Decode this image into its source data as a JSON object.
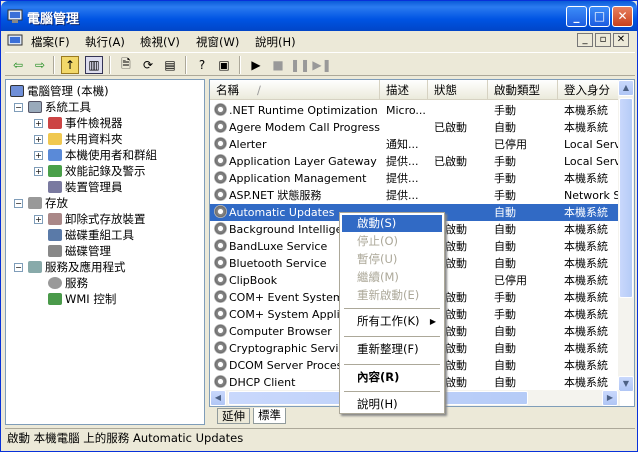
{
  "window": {
    "title": "電腦管理"
  },
  "menu": [
    "檔案(F)",
    "執行(A)",
    "檢視(V)",
    "視窗(W)",
    "說明(H)"
  ],
  "tree": {
    "root": "電腦管理 (本機)",
    "system_tools": "系統工具",
    "event_viewer": "事件檢視器",
    "shared_folders": "共用資料夾",
    "local_users": "本機使用者和群組",
    "perf_logs": "效能記錄及警示",
    "device_manager": "裝置管理員",
    "storage": "存放",
    "removable_storage": "卸除式存放裝置",
    "defrag": "磁碟重組工具",
    "disk_mgmt": "磁碟管理",
    "services_apps": "服務及應用程式",
    "services": "服務",
    "wmi": "WMI 控制"
  },
  "columns": [
    "名稱",
    "描述",
    "狀態",
    "啟動類型",
    "登入身分"
  ],
  "rows": [
    [
      ".NET Runtime Optimization ...",
      "Micro...",
      "",
      "手動",
      "本機系統"
    ],
    [
      "Agere Modem Call Progress ...",
      "",
      "已啟動",
      "自動",
      "本機系統"
    ],
    [
      "Alerter",
      "通知...",
      "",
      "已停用",
      "Local Serv"
    ],
    [
      "Application Layer Gateway S...",
      "提供...",
      "已啟動",
      "手動",
      "Local Serv"
    ],
    [
      "Application Management",
      "提供...",
      "",
      "手動",
      "本機系統"
    ],
    [
      "ASP.NET 狀態服務",
      "提供...",
      "",
      "手動",
      "Network S"
    ],
    [
      "Automatic Updates",
      "",
      "",
      "自動",
      "本機系統"
    ],
    [
      "Background Intelligen",
      "",
      "已啟動",
      "自動",
      "本機系統"
    ],
    [
      "BandLuxe Service",
      "",
      "已啟動",
      "自動",
      "本機系統"
    ],
    [
      "Bluetooth Service",
      "",
      "已啟動",
      "自動",
      "本機系統"
    ],
    [
      "ClipBook",
      "",
      "",
      "已停用",
      "本機系統"
    ],
    [
      "COM+ Event System",
      "",
      "已啟動",
      "手動",
      "本機系統"
    ],
    [
      "COM+ System Applica",
      "",
      "已啟動",
      "手動",
      "本機系統"
    ],
    [
      "Computer Browser",
      "",
      "已啟動",
      "自動",
      "本機系統"
    ],
    [
      "Cryptographic Service",
      "",
      "已啟動",
      "自動",
      "本機系統"
    ],
    [
      "DCOM Server Process",
      "",
      "已啟動",
      "自動",
      "本機系統"
    ],
    [
      "DHCP Client",
      "",
      "已啟動",
      "自動",
      "本機系統"
    ]
  ],
  "context_menu": {
    "start": "啟動(S)",
    "stop": "停止(O)",
    "pause": "暫停(U)",
    "resume": "繼續(M)",
    "restart": "重新啟動(E)",
    "all_tasks": "所有工作(K)",
    "refresh": "重新整理(F)",
    "properties": "內容(R)",
    "help": "說明(H)"
  },
  "tabs": {
    "extended": "延伸",
    "standard": "標準"
  },
  "status": "啟動 本機電腦 上的服務 Automatic Updates",
  "colors": {
    "title": "#0054e3",
    "selection": "#316ac5",
    "face": "#ece9d8"
  }
}
